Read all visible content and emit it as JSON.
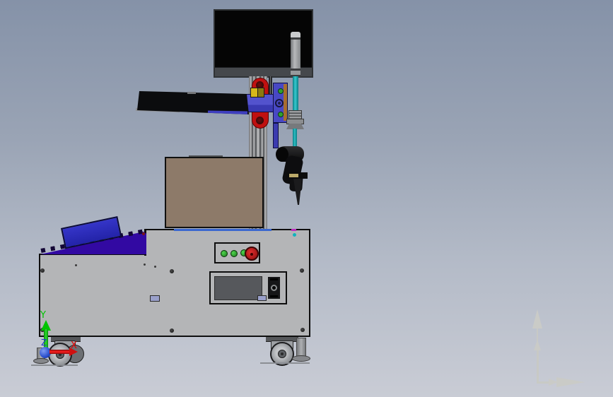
{
  "scene": {
    "app": "cad-viewport",
    "background_top": "#8592a8",
    "background_bottom": "#c9ccd5"
  },
  "origin_triad": {
    "x_label": "X",
    "y_label": "Y",
    "z_label": "Z",
    "x_color": "#e00000",
    "y_color": "#00c400",
    "z_color": "#2438cc"
  },
  "ghost_axis": {
    "color": "#cbccc7"
  },
  "model_colors": {
    "machine_gray": "#b4b5b7",
    "monitor_black": "#050505",
    "box_brown": "#8d7a69",
    "ramp_purple": "#3209a2",
    "bin_blue": "#2c2cc0",
    "bracket_blue": "#4848c4",
    "clamp_red": "#c01010",
    "balancer_cable_teal": "#18a0a8",
    "button_green": "#2fa02f",
    "estop_red": "#b41212",
    "tray_black": "#0b0c0e"
  }
}
